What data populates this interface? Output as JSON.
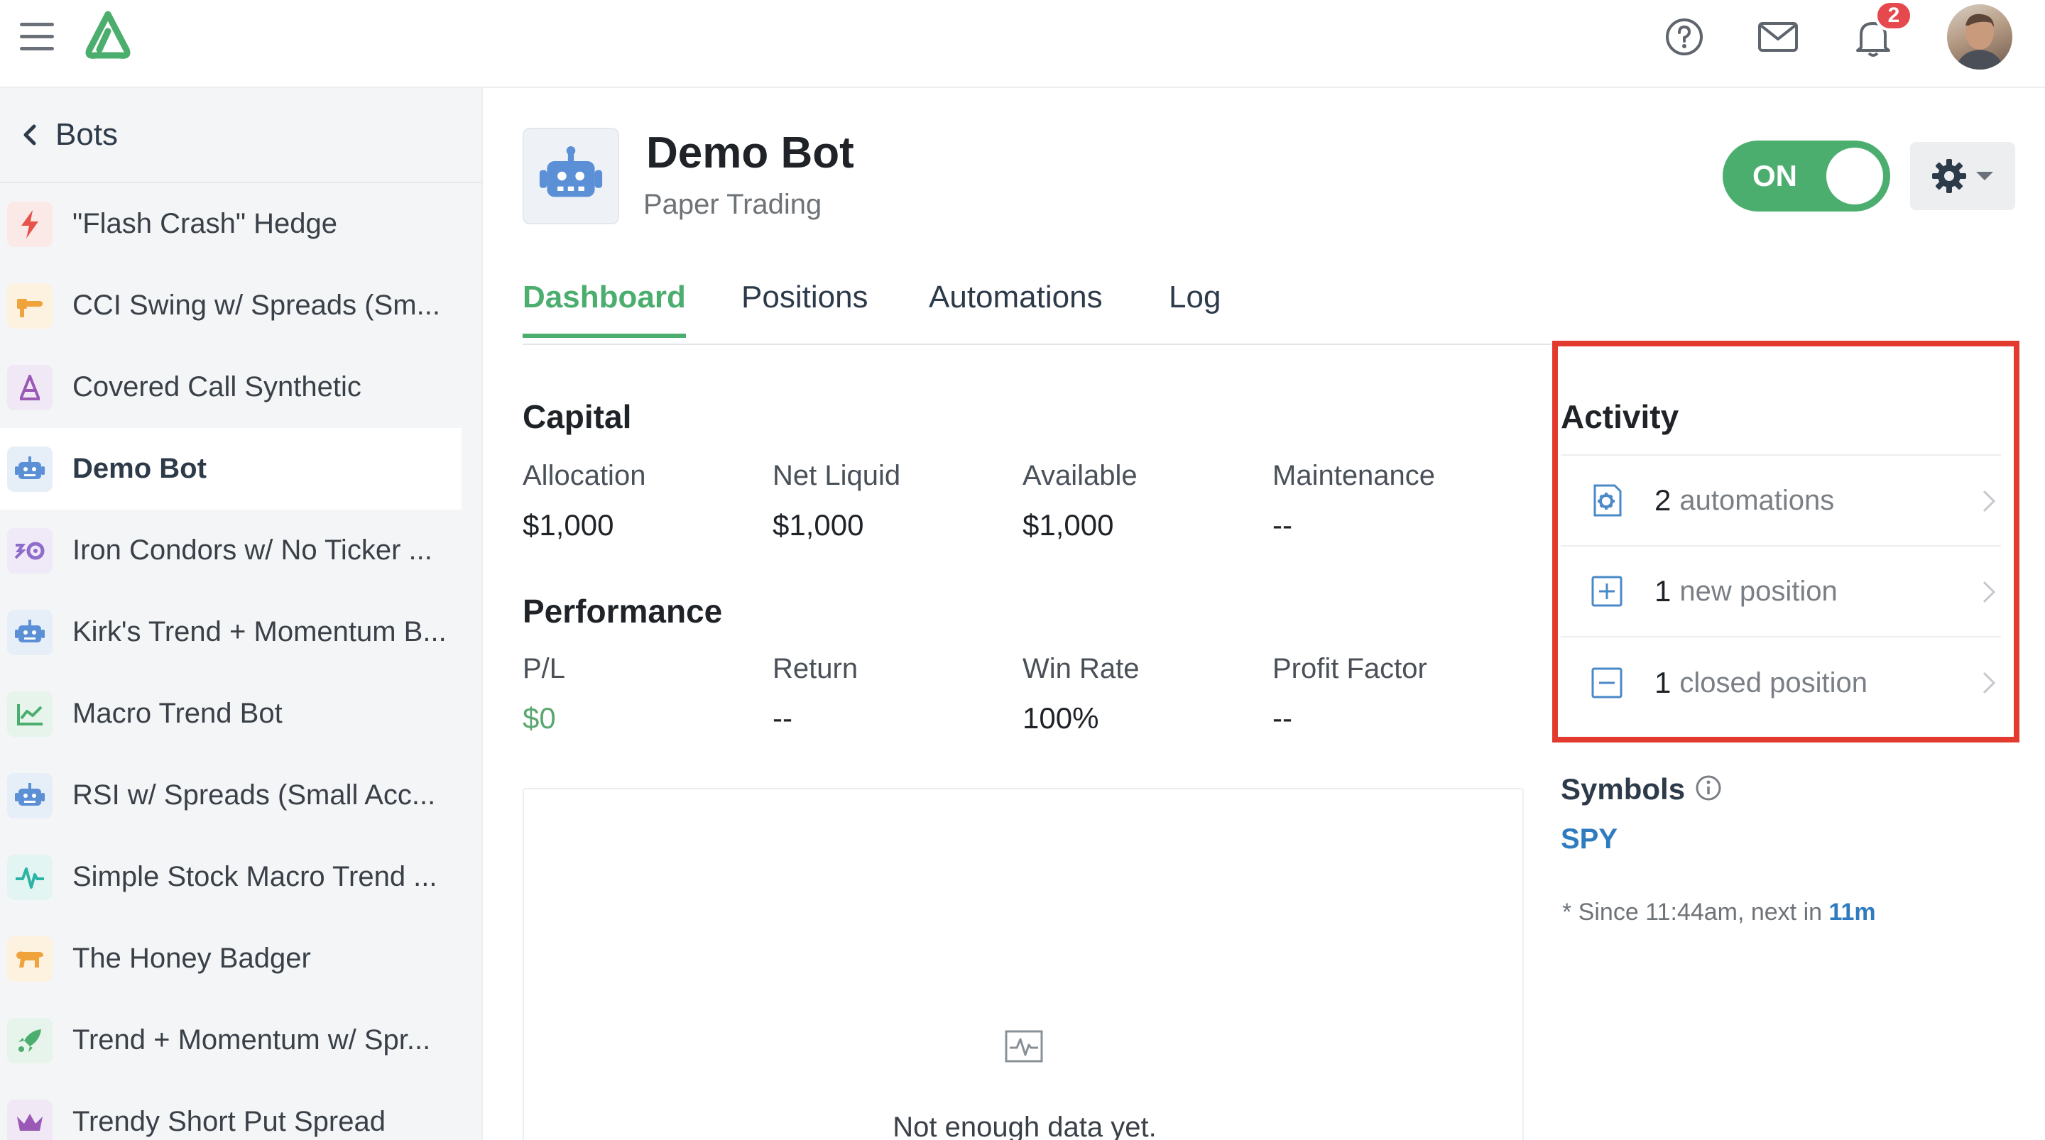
{
  "topbar": {
    "menu_icon": "hamburger-menu-icon",
    "logo_icon": "app-logo-icon",
    "help_icon": "help-circle-icon",
    "mail_icon": "mail-icon",
    "bell_icon": "bell-icon",
    "notification_count": "2"
  },
  "sidebar": {
    "back_label": "Bots",
    "items": [
      {
        "label": "\"Flash Crash\" Hedge",
        "icon": "lightning-icon",
        "color": "#e5534b",
        "bg": "#fbe9e7"
      },
      {
        "label": "CCI Swing w/ Spreads (Sm...",
        "icon": "chainsaw-icon",
        "color": "#f0a23b",
        "bg": "#fdf1e0"
      },
      {
        "label": "Covered Call Synthetic",
        "icon": "compass-icon",
        "color": "#9b59b6",
        "bg": "#f1e8f6"
      },
      {
        "label": "Demo Bot",
        "icon": "robot-icon",
        "color": "#5b8fd6",
        "bg": "#e6eef8"
      },
      {
        "label": "Iron Condors w/ No Ticker ...",
        "icon": "condor-icon",
        "color": "#8e6cc9",
        "bg": "#efe9f8"
      },
      {
        "label": "Kirk's Trend + Momentum B...",
        "icon": "robot-icon",
        "color": "#5b8fd6",
        "bg": "#e6eef8"
      },
      {
        "label": "Macro Trend Bot",
        "icon": "line-chart-icon",
        "color": "#4cae6e",
        "bg": "#e6f4eb"
      },
      {
        "label": "RSI w/ Spreads (Small Acc...",
        "icon": "robot-icon",
        "color": "#5b8fd6",
        "bg": "#e6eef8"
      },
      {
        "label": "Simple Stock Macro Trend ...",
        "icon": "pulse-icon",
        "color": "#2bb3a3",
        "bg": "#e3f5f2"
      },
      {
        "label": "The Honey Badger",
        "icon": "badger-icon",
        "color": "#f0a23b",
        "bg": "#fdf1e0"
      },
      {
        "label": "Trend + Momentum w/ Spr...",
        "icon": "rocket-icon",
        "color": "#4cae6e",
        "bg": "#e6f4eb"
      },
      {
        "label": "Trendy Short Put Spread",
        "icon": "crown-icon",
        "color": "#9b59b6",
        "bg": "#f1e8f6"
      }
    ]
  },
  "header": {
    "title": "Demo Bot",
    "subtitle": "Paper Trading",
    "toggle_label": "ON",
    "settings_icon": "gear-icon"
  },
  "tabs": [
    {
      "label": "Dashboard"
    },
    {
      "label": "Positions"
    },
    {
      "label": "Automations"
    },
    {
      "label": "Log"
    }
  ],
  "capital": {
    "title": "Capital",
    "metrics": [
      {
        "label": "Allocation",
        "value": "$1,000"
      },
      {
        "label": "Net Liquid",
        "value": "$1,000"
      },
      {
        "label": "Available",
        "value": "$1,000"
      },
      {
        "label": "Maintenance",
        "value": "--"
      }
    ]
  },
  "performance": {
    "title": "Performance",
    "metrics": [
      {
        "label": "P/L",
        "value": "$0"
      },
      {
        "label": "Return",
        "value": "--"
      },
      {
        "label": "Win Rate",
        "value": "100%"
      },
      {
        "label": "Profit Factor",
        "value": "--"
      }
    ]
  },
  "chart": {
    "empty_text": "Not enough data yet."
  },
  "activity": {
    "title": "Activity",
    "rows": [
      {
        "count": "2",
        "text": "automations",
        "icon": "automation-gear-icon"
      },
      {
        "count": "1",
        "text": "new position",
        "icon": "plus-square-icon"
      },
      {
        "count": "1",
        "text": "closed position",
        "icon": "minus-square-icon"
      }
    ]
  },
  "symbols": {
    "title": "Symbols",
    "symbol": "SPY",
    "since_prefix": "* Since 11:44am, next in ",
    "next_in": "11m"
  },
  "colors": {
    "accent_green": "#4cae6e",
    "highlight_red": "#e33a2f",
    "link_blue": "#2f7bbf"
  }
}
